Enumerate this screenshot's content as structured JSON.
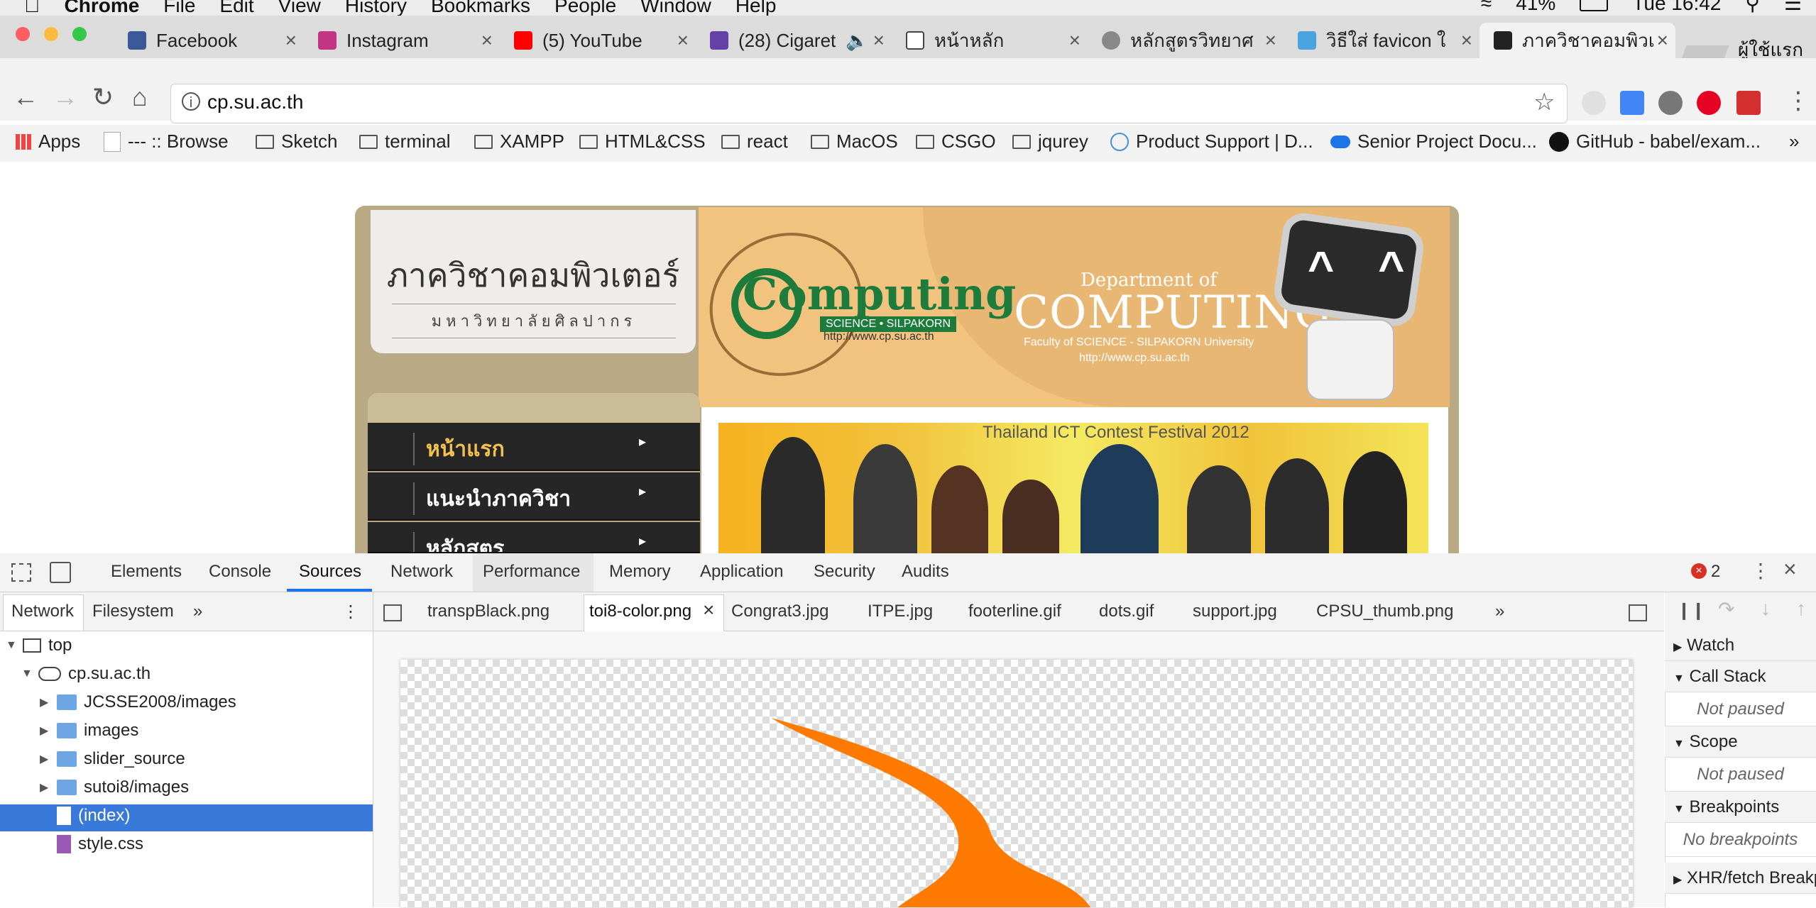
{
  "menubar": {
    "app": "Chrome",
    "items": [
      "File",
      "Edit",
      "View",
      "History",
      "Bookmarks",
      "People",
      "Window",
      "Help"
    ],
    "battery": "41%",
    "clock": "Tue 16:42"
  },
  "tabs": [
    {
      "title": "Facebook",
      "color": "#3b5998"
    },
    {
      "title": "Instagram",
      "color": "#c13584"
    },
    {
      "title": "(5) YouTube",
      "color": "#ff0000"
    },
    {
      "title": "(28) Cigaret",
      "color": "#6441a5"
    },
    {
      "title": "หน้าหลัก",
      "color": "#ffffff"
    },
    {
      "title": "หลักสูตรวิทยาศ",
      "color": "#888888"
    },
    {
      "title": "วิธีใส่ favicon ใ",
      "color": "#4aa3df"
    },
    {
      "title": "ภาควิชาคอมพิวเ",
      "color": "#222222"
    }
  ],
  "profile": "ผู้ใช้แรก",
  "address": {
    "url": "cp.su.ac.th"
  },
  "bookmarks": [
    "Apps",
    "--- :: Browse",
    "Sketch",
    "terminal",
    "XAMPP",
    "HTML&CSS",
    "react",
    "MacOS",
    "CSGO",
    "jqurey",
    "Product Support | D...",
    "Senior Project Docu...",
    "GitHub - babel/exam..."
  ],
  "site": {
    "title": "ภาควิชาคอมพิวเตอร์",
    "subtitle": "มหาวิทยาลัยศิลปากร",
    "logo_text": "Computing",
    "logo_tag": "SCIENCE • SILPAKORN",
    "logo_url": "http://www.cp.su.ac.th",
    "dept_of": "Department of",
    "dept_big": "COMPUTING",
    "dept_faculty": "Faculty of SCIENCE - SILPAKORN University",
    "dept_url": "http://www.cp.su.ac.th",
    "robot_eyes": "^ ^",
    "menu": [
      "หน้าแรก",
      "แนะนำภาควิชา",
      "หลักสูตร"
    ],
    "photo_caption": "Thailand ICT Contest Festival 2012"
  },
  "devtools": {
    "tabs": [
      "Elements",
      "Console",
      "Sources",
      "Network",
      "Performance",
      "Memory",
      "Application",
      "Security",
      "Audits"
    ],
    "error_count": "2",
    "navigator_tabs": [
      "Network",
      "Filesystem"
    ],
    "tree": [
      "top",
      "cp.su.ac.th",
      "JCSSE2008/images",
      "images",
      "slider_source",
      "sutoi8/images",
      "(index)",
      "style.css"
    ],
    "editor_tabs": [
      "transpBlack.png",
      "toi8-color.png",
      "Congrat3.jpg",
      "ITPE.jpg",
      "footerline.gif",
      "dots.gif",
      "support.jpg",
      "CPSU_thumb.png"
    ],
    "debug_sections": [
      "Watch",
      "Call Stack",
      "Scope",
      "Breakpoints",
      "XHR/fetch Breakpoints"
    ],
    "not_paused": "Not paused",
    "no_breakpoints": "No breakpoints"
  }
}
